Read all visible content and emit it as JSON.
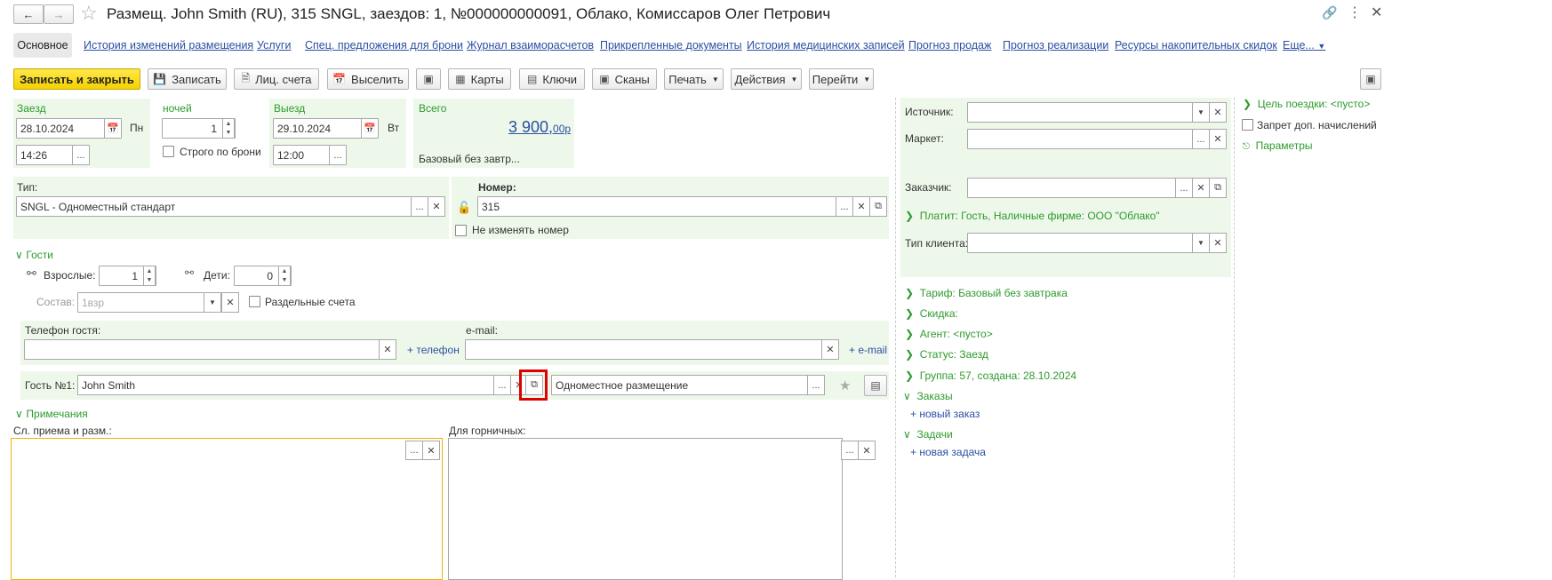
{
  "window": {
    "title": "Размещ. John Smith (RU), 315 SNGL, заездов: 1, №000000000091, Облако, Комиссаров Олег Петрович",
    "back_icon": "arrow-left-icon",
    "forward_icon": "arrow-right-icon",
    "star_icon": "star-icon",
    "link_icon": "link-icon",
    "more_icon": "more-vertical-icon",
    "close_icon": "close-icon"
  },
  "tabs": [
    "Основное",
    "История изменений размещения",
    "Услуги",
    "Спец. предложения для брони",
    "Журнал взаиморасчетов",
    "Прикрепленные документы",
    "История медицинских записей",
    "Прогноз продаж",
    "Прогноз реализации",
    "Ресурсы накопительных скидок",
    "Еще..."
  ],
  "toolbar": {
    "save_close": "Записать и закрыть",
    "save": "Записать",
    "accounts": "Лиц. счета",
    "checkout": "Выселить",
    "cards": "Карты",
    "keys": "Ключи",
    "scans": "Сканы",
    "print": "Печать",
    "actions": "Действия",
    "goto": "Перейти"
  },
  "checkin": {
    "label": "Заезд",
    "date": "28.10.2024",
    "day": "Пн",
    "time": "14:26"
  },
  "nights": {
    "label": "ночей",
    "value": "1",
    "strict_label": "Строго по брони"
  },
  "checkout": {
    "label": "Выезд",
    "date": "29.10.2024",
    "day": "Вт",
    "time": "12:00"
  },
  "total": {
    "label": "Всего",
    "amount": "3 900,",
    "cents": "00р",
    "tariff": "Базовый без завтр..."
  },
  "room_type": {
    "label": "Тип:",
    "value": "SNGL - Одноместный стандарт"
  },
  "room": {
    "label": "Номер:",
    "value": "315",
    "keep_label": "Не изменять номер"
  },
  "guests": {
    "section": "Гости",
    "adults_label": "Взрослые:",
    "adults": "1",
    "children_label": "Дети:",
    "children": "0",
    "composition_label": "Состав:",
    "composition_placeholder": "1взр",
    "separate_label": "Раздельные счета",
    "phone_label": "Телефон гостя:",
    "add_phone": "+ телефон",
    "email_label": "e-mail:",
    "add_email": "+ e-mail",
    "guest1_label": "Гость №1:",
    "guest1_value": "John Smith",
    "accommodation_value": "Одноместное размещение"
  },
  "notes": {
    "section": "Примечания",
    "reception_label": "Сл. приема и разм.:",
    "housekeeping_label": "Для горничных:"
  },
  "right": {
    "source_label": "Источник:",
    "market_label": "Маркет:",
    "customer_label": "Заказчик:",
    "payer": "Платит: Гость, Наличные фирме: ООО \"Облако\"",
    "client_type_label": "Тип клиента:",
    "tariff": "Тариф: Базовый без завтрака",
    "discount": "Скидка:",
    "agent": "Агент: <пусто>",
    "status": "Статус: Заезд",
    "group": "Группа: 57, создана: 28.10.2024",
    "orders": "Заказы",
    "new_order": "+ новый заказ",
    "tasks": "Задачи",
    "new_task": "+ новая задача"
  },
  "far_right": {
    "purpose": "Цель поездки: <пусто>",
    "ban_label": "Запрет доп. начислений",
    "params": "Параметры"
  },
  "colors": {
    "accent": "#2d9a2d",
    "link": "#2b4fa3",
    "highlight": "#e00000",
    "primary": "#f5d200"
  }
}
